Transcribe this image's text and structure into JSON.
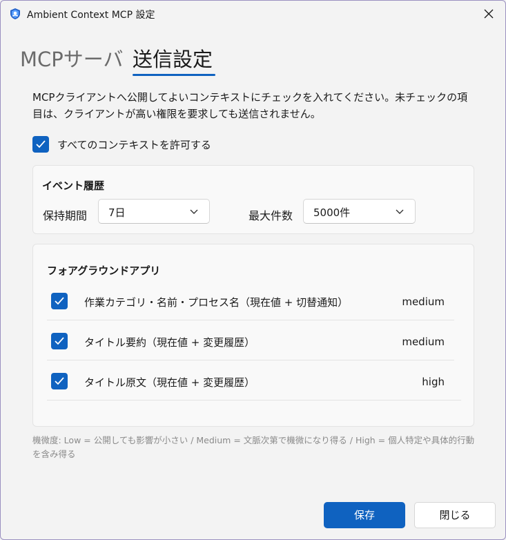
{
  "window": {
    "title": "Ambient Context MCP 設定"
  },
  "tabs": [
    {
      "label": "MCPサーバ",
      "active": false
    },
    {
      "label": "送信設定",
      "active": true
    }
  ],
  "description": "MCPクライアントへ公開してよいコンテキストにチェックを入れてください。未チェックの項目は、クライアントが高い権限を要求しても送信されません。",
  "allow_all": {
    "label": "すべてのコンテキストを許可する",
    "checked": true
  },
  "event_history": {
    "title": "イベント履歴",
    "retention": {
      "label": "保持期間",
      "value": "7日"
    },
    "max_count": {
      "label": "最大件数",
      "value": "5000件"
    }
  },
  "foreground_app": {
    "title": "フォアグラウンドアプリ",
    "items": [
      {
        "label": "作業カテゴリ・名前・プロセス名（現在値 + 切替通知）",
        "level": "medium",
        "checked": true
      },
      {
        "label": "タイトル要約（現在値 + 変更履歴）",
        "level": "medium",
        "checked": true
      },
      {
        "label": "タイトル原文（現在値 + 変更履歴）",
        "level": "high",
        "checked": true
      }
    ]
  },
  "footnote": "機微度: Low = 公開しても影響が小さい / Medium = 文脈次第で機微になり得る / High = 個人特定や具体的行動を含み得る",
  "buttons": {
    "save": "保存",
    "close": "閉じる"
  },
  "colors": {
    "accent": "#0f62c0",
    "background": "#f3f3f3",
    "card": "#f9f9f9"
  },
  "icons": {
    "app": "shield-icon",
    "close": "close-icon",
    "dropdown": "chevron-down-icon",
    "check": "checkmark-icon"
  }
}
